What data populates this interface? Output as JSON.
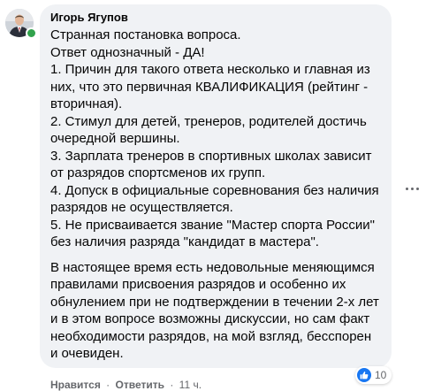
{
  "comment": {
    "author": "Игорь Ягупов",
    "lines": [
      "Странная постановка вопроса.",
      "Ответ однозначный - ДА!",
      "1. Причин для такого ответа несколько и главная из",
      "них, что это первичная КВАЛИФИКАЦИЯ (рейтинг -",
      "вторичная).",
      "2. Стимул для детей, тренеров, родителей достичь",
      "очередной вершины.",
      "3. Зарплата тренеров в спортивных школах зависит",
      "от разрядов спортсменов их групп.",
      "4. Допуск в официальные соревнования без наличия",
      "разрядов не осуществляется.",
      "5. Не присваивается звание \"Мастер спорта России\"",
      "без наличия разряда \"кандидат в мастера\"."
    ],
    "lines2": [
      "В настоящее время есть недовольные меняющимся",
      "правилами присвоения разрядов и особенно их",
      "обнулением при не подтверждении в течении 2-х лет",
      "и в этом вопросе возможны дискуссии, но сам факт",
      "необходимости разрядов, на мой взгляд, бесспорен",
      "и очевиден."
    ],
    "reaction_count": "10",
    "reaction_icon": "like-icon",
    "online": true
  },
  "footer": {
    "like_label": "Нравится",
    "separator": "·",
    "reply_label": "Ответить",
    "time": "11 ч."
  },
  "colors": {
    "bubble": "#f0f2f5",
    "link": "#65676b",
    "like_blue": "#1877f2",
    "online_green": "#31a24c"
  }
}
